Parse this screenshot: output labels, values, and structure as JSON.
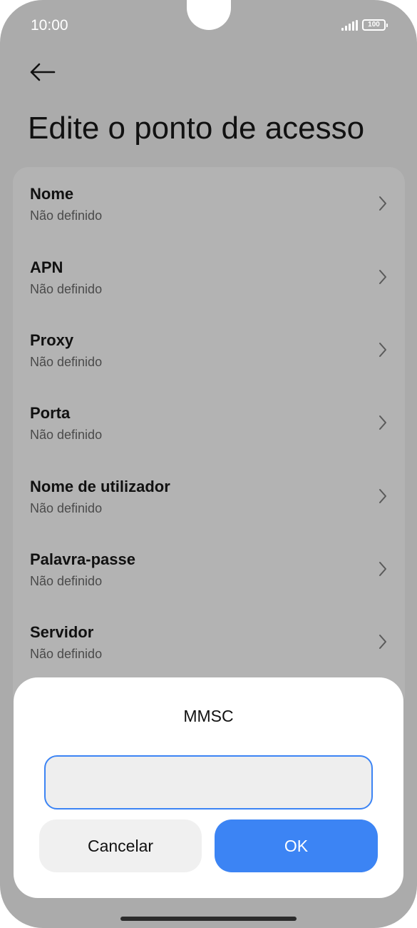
{
  "status_bar": {
    "time": "10:00",
    "battery_level": "100",
    "signal_icon": "signal-bars-icon",
    "battery_icon": "battery-icon"
  },
  "header": {
    "back_icon": "arrow-left-icon",
    "title": "Edite o ponto de acesso"
  },
  "settings": {
    "items": [
      {
        "label": "Nome",
        "value": "Não definido"
      },
      {
        "label": "APN",
        "value": "Não definido"
      },
      {
        "label": "Proxy",
        "value": "Não definido"
      },
      {
        "label": "Porta",
        "value": "Não definido"
      },
      {
        "label": "Nome de utilizador",
        "value": "Não definido"
      },
      {
        "label": "Palavra-passe",
        "value": "Não definido"
      },
      {
        "label": "Servidor",
        "value": "Não definido"
      }
    ]
  },
  "dialog": {
    "title": "MMSC",
    "input_value": "",
    "cancel_label": "Cancelar",
    "ok_label": "OK"
  },
  "colors": {
    "accent": "#3c84f4",
    "background_dimmed": "#ababab",
    "card": "#b3b3b3"
  }
}
